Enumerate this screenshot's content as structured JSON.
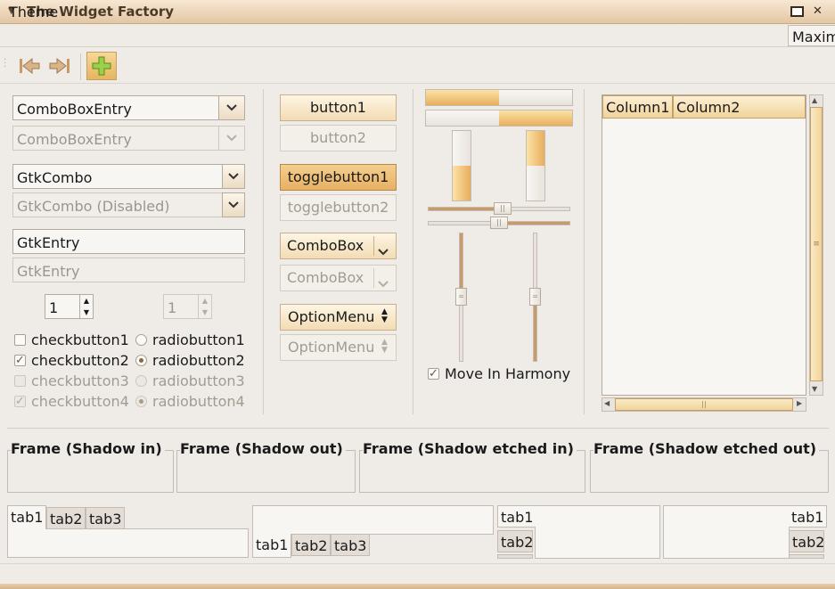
{
  "window": {
    "title": "The Widget Factory"
  },
  "menubar": {
    "theme": "Theme",
    "right_item": "Maxim"
  },
  "toolbar": {
    "icons": [
      "back-icon",
      "forward-icon",
      "add-icon"
    ]
  },
  "col1": {
    "combo_entry": "ComboBoxEntry",
    "combo_entry_disabled": "ComboBoxEntry",
    "gtk_combo": "GtkCombo",
    "gtk_combo_disabled": "GtkCombo (Disabled)",
    "entry": "GtkEntry",
    "entry_disabled": "GtkEntry",
    "spin_value": "1",
    "spin_disabled_value": "1",
    "checks": [
      "checkbutton1",
      "checkbutton2",
      "checkbutton3",
      "checkbutton4"
    ],
    "radios": [
      "radiobutton1",
      "radiobutton2",
      "radiobutton3",
      "radiobutton4"
    ]
  },
  "col2": {
    "button1": "button1",
    "button2": "button2",
    "toggle1": "togglebutton1",
    "toggle2": "togglebutton2",
    "combobox": "ComboBox",
    "combobox_disabled": "ComboBox",
    "optionmenu": "OptionMenu",
    "optionmenu_disabled": "OptionMenu"
  },
  "col3": {
    "hprogress1": 0.5,
    "hprogress2": 0.5,
    "vprogress1": 0.5,
    "vprogress2": 0.5,
    "harmony": "Move In Harmony"
  },
  "tree": {
    "columns": [
      "Column1",
      "Column2"
    ]
  },
  "frames": [
    "Frame (Shadow in)",
    "Frame (Shadow out)",
    "Frame (Shadow etched in)",
    "Frame (Shadow etched out)"
  ],
  "notebooks": {
    "tabs": [
      "tab1",
      "tab2",
      "tab3"
    ]
  }
}
